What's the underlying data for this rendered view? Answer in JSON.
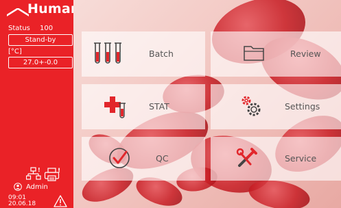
{
  "brand": {
    "name": "Human"
  },
  "status": {
    "label": "Status",
    "value": "100",
    "state": "Stand-by"
  },
  "temperature": {
    "unit": "[°C]",
    "value": "27.0+-0.0"
  },
  "user": {
    "name": "Admin"
  },
  "clock": {
    "time": "09:01",
    "date": "20.06.18"
  },
  "tiles": {
    "batch": "Batch",
    "review": "Review",
    "stat": "STAT",
    "settings": "Settings",
    "qc": "QC",
    "service": "Service"
  },
  "colors": {
    "brand_red": "#ea2227",
    "tile_bg": "#ffffff"
  }
}
